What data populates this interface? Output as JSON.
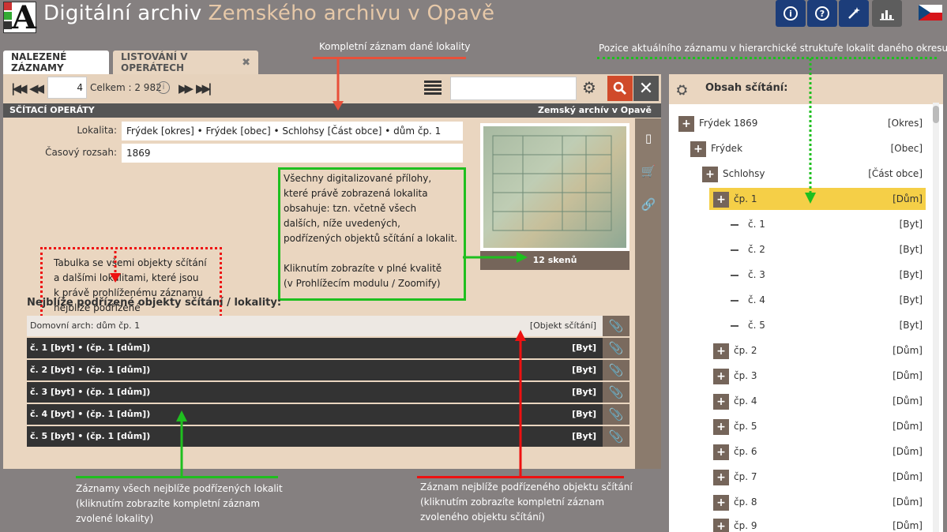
{
  "header": {
    "title": "Digitální archiv",
    "subtitle": "Zemského archivu v Opavě",
    "buttons": [
      "info-icon",
      "help-icon",
      "magic-wand-icon",
      "stats-icon"
    ],
    "flag": "czech-flag"
  },
  "tabs": [
    {
      "label": "NALEZENÉ ZÁZNAMY",
      "active": true
    },
    {
      "label": "LISTOVÁNÍ V OPERÁTECH",
      "active": false,
      "close": "✖"
    }
  ],
  "toolbar": {
    "record_number": "4",
    "total": "Celkem : 2 982",
    "search_value": ""
  },
  "section": {
    "title": "SČÍTACÍ OPERÁTY",
    "archive": "Zemský archív v Opavě"
  },
  "fields": {
    "lokalita_label": "Lokalita:",
    "lokalita_value": "Frýdek [okres] • Frýdek [obec] • Schlohsy [Část obce] • dům čp. 1",
    "rozsah_label": "Časový rozsah:",
    "rozsah_value": "1869"
  },
  "scans": {
    "caption": "12 skenů"
  },
  "subheading": "Nejblíže podřízené objekty sčítání / lokality:",
  "rows": [
    {
      "name": "Domovní arch: dům čp. 1",
      "type": "[Objekt sčítání]",
      "style": "light"
    },
    {
      "name": "č. 1 [byt] • (čp. 1 [dům])",
      "type": "[Byt]",
      "style": "dark"
    },
    {
      "name": "č. 2 [byt] • (čp. 1 [dům])",
      "type": "[Byt]",
      "style": "dark"
    },
    {
      "name": "č. 3 [byt] • (čp. 1 [dům])",
      "type": "[Byt]",
      "style": "dark"
    },
    {
      "name": "č. 4 [byt] • (čp. 1 [dům])",
      "type": "[Byt]",
      "style": "dark"
    },
    {
      "name": "č. 5 [byt] • (čp. 1 [dům])",
      "type": "[Byt]",
      "style": "dark"
    }
  ],
  "right_panel": {
    "title": "Obsah sčítání:",
    "tree": [
      {
        "label": "Frýdek 1869",
        "type": "[Okres]",
        "icon": "plus",
        "level": 0
      },
      {
        "label": "Frýdek",
        "type": "[Obec]",
        "icon": "plus",
        "level": 1
      },
      {
        "label": "Schlohsy",
        "type": "[Část obce]",
        "icon": "plus",
        "level": 2
      },
      {
        "label": "čp. 1",
        "type": "[Dům]",
        "icon": "plus",
        "level": 3,
        "selected": true
      },
      {
        "label": "č. 1",
        "type": "[Byt]",
        "icon": "dash",
        "level": 4
      },
      {
        "label": "č. 2",
        "type": "[Byt]",
        "icon": "dash",
        "level": 4
      },
      {
        "label": "č. 3",
        "type": "[Byt]",
        "icon": "dash",
        "level": 4
      },
      {
        "label": "č. 4",
        "type": "[Byt]",
        "icon": "dash",
        "level": 4
      },
      {
        "label": "č. 5",
        "type": "[Byt]",
        "icon": "dash",
        "level": 4
      },
      {
        "label": "čp. 2",
        "type": "[Dům]",
        "icon": "plus",
        "level": 3
      },
      {
        "label": "čp. 3",
        "type": "[Dům]",
        "icon": "plus",
        "level": 3
      },
      {
        "label": "čp. 4",
        "type": "[Dům]",
        "icon": "plus",
        "level": 3
      },
      {
        "label": "čp. 5",
        "type": "[Dům]",
        "icon": "plus",
        "level": 3
      },
      {
        "label": "čp. 6",
        "type": "[Dům]",
        "icon": "plus",
        "level": 3
      },
      {
        "label": "čp. 7",
        "type": "[Dům]",
        "icon": "plus",
        "level": 3
      },
      {
        "label": "čp. 8",
        "type": "[Dům]",
        "icon": "plus",
        "level": 3
      },
      {
        "label": "čp. 9",
        "type": "[Dům]",
        "icon": "plus",
        "level": 3
      }
    ]
  },
  "annotations": {
    "top_center": "Kompletní záznam dané lokality",
    "top_right": "Pozice aktuálního záznamu v hierarchické struktuře lokalit daného okresu",
    "red_box": [
      "Tabulka se všemi objekty sčítání",
      "a dalšími lokalitami, které jsou",
      "k právě prohlíženému záznamu",
      "nejblíže podřízené"
    ],
    "green_box": [
      "Všechny digitalizované přílohy,",
      "které právě zobrazená lokalita",
      "obsahuje: tzn. včetně všech",
      "dalších, níže uvedených,",
      "podřízených objektů sčítání a lokalit.",
      "",
      "Kliknutím zobrazíte v plné kvalitě",
      "(v Prohlížecím modulu / Zoomify)"
    ],
    "bottom_left": [
      "Záznamy všech nejblíže podřízených lokalit",
      "(kliknutím zobrazíte kompletní záznam",
      "zvolené lokality)"
    ],
    "bottom_right": [
      "Záznam nejblíže podřízeného objektu sčítání",
      "(kliknutím zobrazíte kompletní záznam",
      "zvoleného objektu sčítání)"
    ]
  },
  "colors": {
    "background": "#858080",
    "panel": "#ead6c0",
    "accent_red": "#e11",
    "accent_green": "#1fbf1f",
    "selected": "#f5cf47",
    "header_blue": "#1c3d7a"
  }
}
